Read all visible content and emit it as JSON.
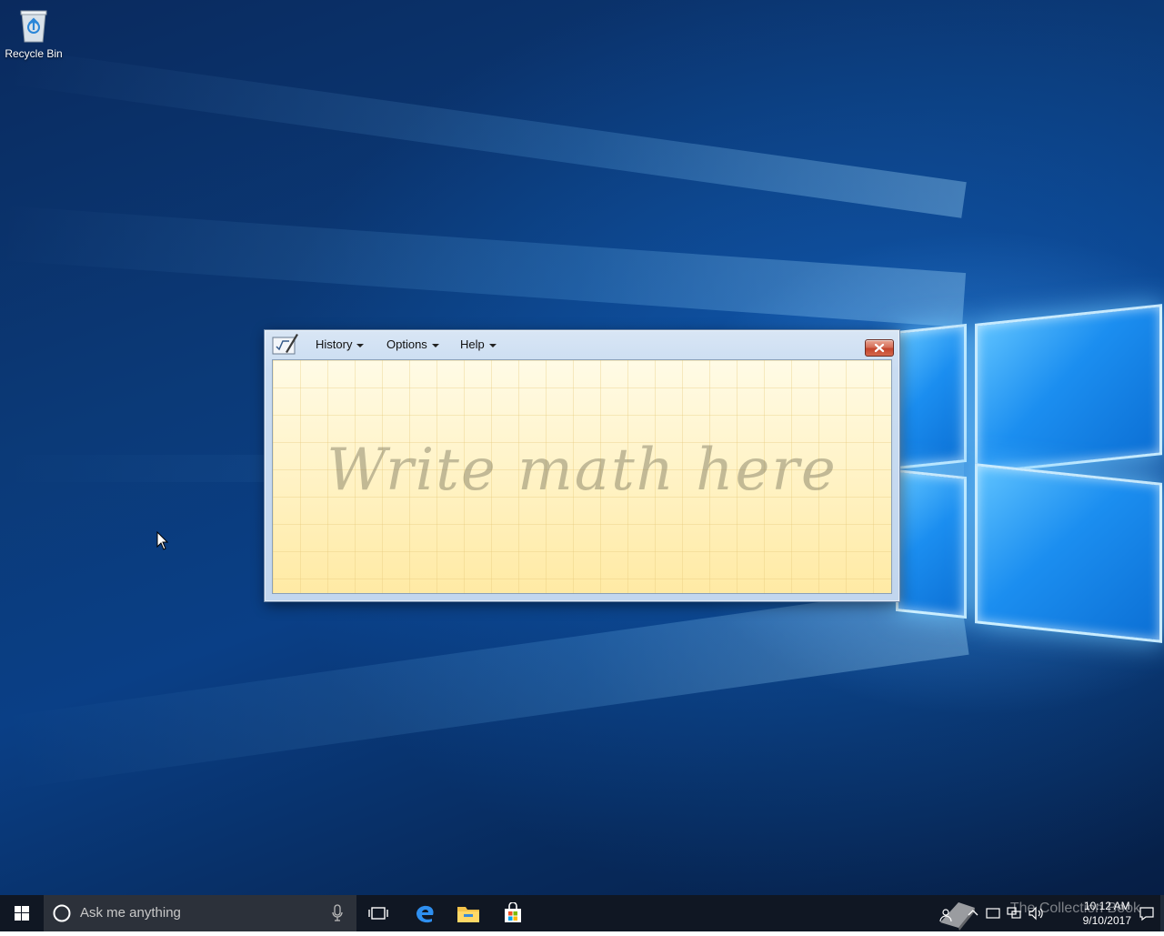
{
  "desktop": {
    "icons": [
      {
        "label": "Recycle Bin"
      }
    ]
  },
  "math_input_panel": {
    "menus": [
      {
        "label": "History"
      },
      {
        "label": "Options"
      },
      {
        "label": "Help"
      }
    ],
    "placeholder": "Write math here",
    "close_icon": "close-icon"
  },
  "taskbar": {
    "search_placeholder": "Ask me anything",
    "pinned": [
      {
        "name": "task-view-icon"
      },
      {
        "name": "edge-icon"
      },
      {
        "name": "file-explorer-icon"
      },
      {
        "name": "store-icon"
      }
    ],
    "clock": {
      "time": "10:12 AM",
      "date": "9/10/2017"
    },
    "watermark": "The Collection Book"
  },
  "colors": {
    "taskbar_bg": "#101723",
    "writing_area_bg": "#fff4c4",
    "close_button": "#c4452c"
  }
}
